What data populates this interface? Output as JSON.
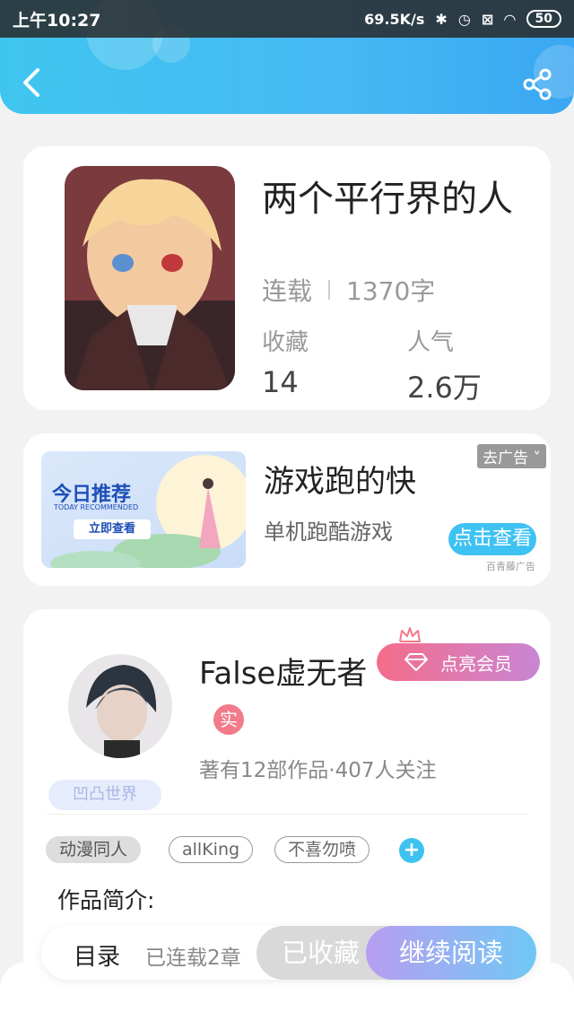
{
  "status_bar": {
    "time": "上午10:27",
    "network_speed": "69.5K/s",
    "battery": "50"
  },
  "book": {
    "title": "两个平行界的人",
    "status": "连载",
    "word_count": "1370字",
    "favorites_label": "收藏",
    "favorites_value": "14",
    "popularity_label": "人气",
    "popularity_value": "2.6万"
  },
  "ad": {
    "banner_title": "今日推荐",
    "banner_subtitle": "TODAY RECOMMENDED",
    "banner_cta": "立即查看",
    "title": "游戏跑的快",
    "subtitle": "单机跑酷游戏",
    "close_label": "去广告",
    "cta": "点击查看",
    "source": "百青藤广告"
  },
  "author": {
    "name": "False虚无者",
    "vip_button": "点亮会员",
    "real_badge": "实",
    "stats": "著有12部作品·407人关注",
    "world_badge": "凹凸世界",
    "tags": [
      "动漫同人",
      "allKing",
      "不喜勿喷"
    ],
    "add_tag": "+",
    "intro_label": "作品简介:"
  },
  "bottom_bar": {
    "toc_label": "目录",
    "toc_count": "已连载2章",
    "favorite_button": "已收藏",
    "read_button": "继续阅读"
  },
  "colors": {
    "header": "#47b8f3",
    "accent": "#3ec2f2",
    "vip_start": "#f56c8a",
    "vip_end": "#c886d4"
  }
}
